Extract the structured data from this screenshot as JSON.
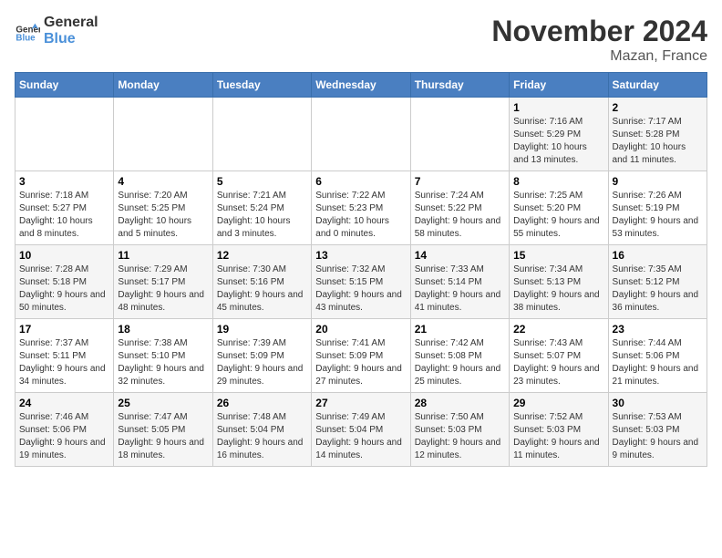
{
  "header": {
    "logo_general": "General",
    "logo_blue": "Blue",
    "month_title": "November 2024",
    "location": "Mazan, France"
  },
  "calendar": {
    "days_of_week": [
      "Sunday",
      "Monday",
      "Tuesday",
      "Wednesday",
      "Thursday",
      "Friday",
      "Saturday"
    ],
    "weeks": [
      [
        {
          "day": "",
          "info": ""
        },
        {
          "day": "",
          "info": ""
        },
        {
          "day": "",
          "info": ""
        },
        {
          "day": "",
          "info": ""
        },
        {
          "day": "",
          "info": ""
        },
        {
          "day": "1",
          "info": "Sunrise: 7:16 AM\nSunset: 5:29 PM\nDaylight: 10 hours and 13 minutes."
        },
        {
          "day": "2",
          "info": "Sunrise: 7:17 AM\nSunset: 5:28 PM\nDaylight: 10 hours and 11 minutes."
        }
      ],
      [
        {
          "day": "3",
          "info": "Sunrise: 7:18 AM\nSunset: 5:27 PM\nDaylight: 10 hours and 8 minutes."
        },
        {
          "day": "4",
          "info": "Sunrise: 7:20 AM\nSunset: 5:25 PM\nDaylight: 10 hours and 5 minutes."
        },
        {
          "day": "5",
          "info": "Sunrise: 7:21 AM\nSunset: 5:24 PM\nDaylight: 10 hours and 3 minutes."
        },
        {
          "day": "6",
          "info": "Sunrise: 7:22 AM\nSunset: 5:23 PM\nDaylight: 10 hours and 0 minutes."
        },
        {
          "day": "7",
          "info": "Sunrise: 7:24 AM\nSunset: 5:22 PM\nDaylight: 9 hours and 58 minutes."
        },
        {
          "day": "8",
          "info": "Sunrise: 7:25 AM\nSunset: 5:20 PM\nDaylight: 9 hours and 55 minutes."
        },
        {
          "day": "9",
          "info": "Sunrise: 7:26 AM\nSunset: 5:19 PM\nDaylight: 9 hours and 53 minutes."
        }
      ],
      [
        {
          "day": "10",
          "info": "Sunrise: 7:28 AM\nSunset: 5:18 PM\nDaylight: 9 hours and 50 minutes."
        },
        {
          "day": "11",
          "info": "Sunrise: 7:29 AM\nSunset: 5:17 PM\nDaylight: 9 hours and 48 minutes."
        },
        {
          "day": "12",
          "info": "Sunrise: 7:30 AM\nSunset: 5:16 PM\nDaylight: 9 hours and 45 minutes."
        },
        {
          "day": "13",
          "info": "Sunrise: 7:32 AM\nSunset: 5:15 PM\nDaylight: 9 hours and 43 minutes."
        },
        {
          "day": "14",
          "info": "Sunrise: 7:33 AM\nSunset: 5:14 PM\nDaylight: 9 hours and 41 minutes."
        },
        {
          "day": "15",
          "info": "Sunrise: 7:34 AM\nSunset: 5:13 PM\nDaylight: 9 hours and 38 minutes."
        },
        {
          "day": "16",
          "info": "Sunrise: 7:35 AM\nSunset: 5:12 PM\nDaylight: 9 hours and 36 minutes."
        }
      ],
      [
        {
          "day": "17",
          "info": "Sunrise: 7:37 AM\nSunset: 5:11 PM\nDaylight: 9 hours and 34 minutes."
        },
        {
          "day": "18",
          "info": "Sunrise: 7:38 AM\nSunset: 5:10 PM\nDaylight: 9 hours and 32 minutes."
        },
        {
          "day": "19",
          "info": "Sunrise: 7:39 AM\nSunset: 5:09 PM\nDaylight: 9 hours and 29 minutes."
        },
        {
          "day": "20",
          "info": "Sunrise: 7:41 AM\nSunset: 5:09 PM\nDaylight: 9 hours and 27 minutes."
        },
        {
          "day": "21",
          "info": "Sunrise: 7:42 AM\nSunset: 5:08 PM\nDaylight: 9 hours and 25 minutes."
        },
        {
          "day": "22",
          "info": "Sunrise: 7:43 AM\nSunset: 5:07 PM\nDaylight: 9 hours and 23 minutes."
        },
        {
          "day": "23",
          "info": "Sunrise: 7:44 AM\nSunset: 5:06 PM\nDaylight: 9 hours and 21 minutes."
        }
      ],
      [
        {
          "day": "24",
          "info": "Sunrise: 7:46 AM\nSunset: 5:06 PM\nDaylight: 9 hours and 19 minutes."
        },
        {
          "day": "25",
          "info": "Sunrise: 7:47 AM\nSunset: 5:05 PM\nDaylight: 9 hours and 18 minutes."
        },
        {
          "day": "26",
          "info": "Sunrise: 7:48 AM\nSunset: 5:04 PM\nDaylight: 9 hours and 16 minutes."
        },
        {
          "day": "27",
          "info": "Sunrise: 7:49 AM\nSunset: 5:04 PM\nDaylight: 9 hours and 14 minutes."
        },
        {
          "day": "28",
          "info": "Sunrise: 7:50 AM\nSunset: 5:03 PM\nDaylight: 9 hours and 12 minutes."
        },
        {
          "day": "29",
          "info": "Sunrise: 7:52 AM\nSunset: 5:03 PM\nDaylight: 9 hours and 11 minutes."
        },
        {
          "day": "30",
          "info": "Sunrise: 7:53 AM\nSunset: 5:03 PM\nDaylight: 9 hours and 9 minutes."
        }
      ]
    ]
  }
}
